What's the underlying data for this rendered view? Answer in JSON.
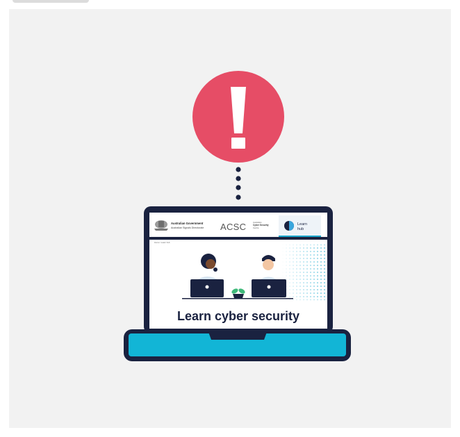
{
  "alert": {
    "icon": "exclamation-icon",
    "color": "#e64d66"
  },
  "laptop": {
    "frame_color": "#1a2240",
    "base_color": "#12b5d6"
  },
  "site": {
    "gov_line1": "Australian Government",
    "gov_line2": "Australian Signals Directorate",
    "acsc_logo": "ACSC",
    "acsc_line1": "Australian",
    "acsc_line2": "Cyber Security",
    "acsc_line3": "Centre",
    "learn_hub_line1": "Learn",
    "learn_hub_line2": "hub",
    "breadcrumb": "Home / Learn hub",
    "hero_title": "Learn cyber security",
    "accent_color": "#1aa9cf"
  }
}
